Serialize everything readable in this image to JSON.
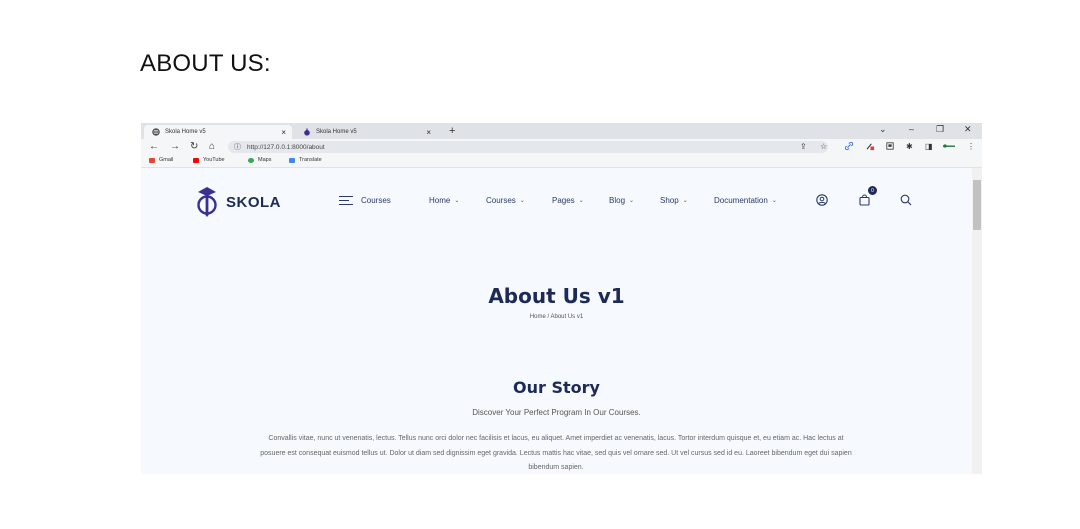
{
  "page_heading": "ABOUT US:",
  "browser": {
    "tabs": [
      {
        "title": "Skola Home v5",
        "close": "×"
      },
      {
        "title": "Skola Home v5",
        "close": "×"
      }
    ],
    "new_tab": "+",
    "window_controls": {
      "collapse": "⌄",
      "minimize": "–",
      "restore": "❐",
      "close": "✕"
    },
    "nav": {
      "back": "←",
      "forward": "→",
      "reload": "↻",
      "home": "⌂"
    },
    "url": "http://127.0.0.1:8000/about",
    "url_info_icon": "ⓘ",
    "extensions": {
      "share": "⇪",
      "star": "☆",
      "link": "🔗",
      "puzzle": "✱",
      "sidebar": "◨",
      "menu": "⋮"
    },
    "bookmarks": [
      {
        "label": "Gmail",
        "color": "#ea4335"
      },
      {
        "label": "YouTube",
        "color": "#ff0000"
      },
      {
        "label": "Maps",
        "color": "#34a853"
      },
      {
        "label": "Translate",
        "color": "#4285f4"
      }
    ]
  },
  "site": {
    "logo_text": "SKOLA",
    "courses_toggle": "Courses",
    "menu": [
      {
        "label": "Home",
        "chevron": "⌄"
      },
      {
        "label": "Courses",
        "chevron": "⌄"
      },
      {
        "label": "Pages",
        "chevron": "⌄"
      },
      {
        "label": "Blog",
        "chevron": "⌄"
      },
      {
        "label": "Shop",
        "chevron": "⌄"
      },
      {
        "label": "Documentation",
        "chevron": "⌄"
      }
    ],
    "cart_count": "0",
    "hero_title": "About Us v1",
    "breadcrumb": "Home  /  About Us v1",
    "story_title": "Our Story",
    "story_subtitle": "Discover Your Perfect Program In Our Courses.",
    "story_body": "Convallis vitae, nunc ut venenatis, lectus. Tellus nunc orci dolor nec facilisis et lacus, eu aliquet. Amet imperdiet ac venenatis, lacus. Tortor interdum quisque et, eu etiam ac. Hac lectus at posuere est consequat euismod tellus ut. Dolor ut diam sed dignissim eget gravida. Lectus mattis hac vitae, sed quis vel ornare sed. Ut vel cursus sed id eu. Laoreet bibendum eget dui sapien bibendum sapien.",
    "colors": {
      "brand": "#1d2a57",
      "background": "#f6f9fd"
    }
  }
}
